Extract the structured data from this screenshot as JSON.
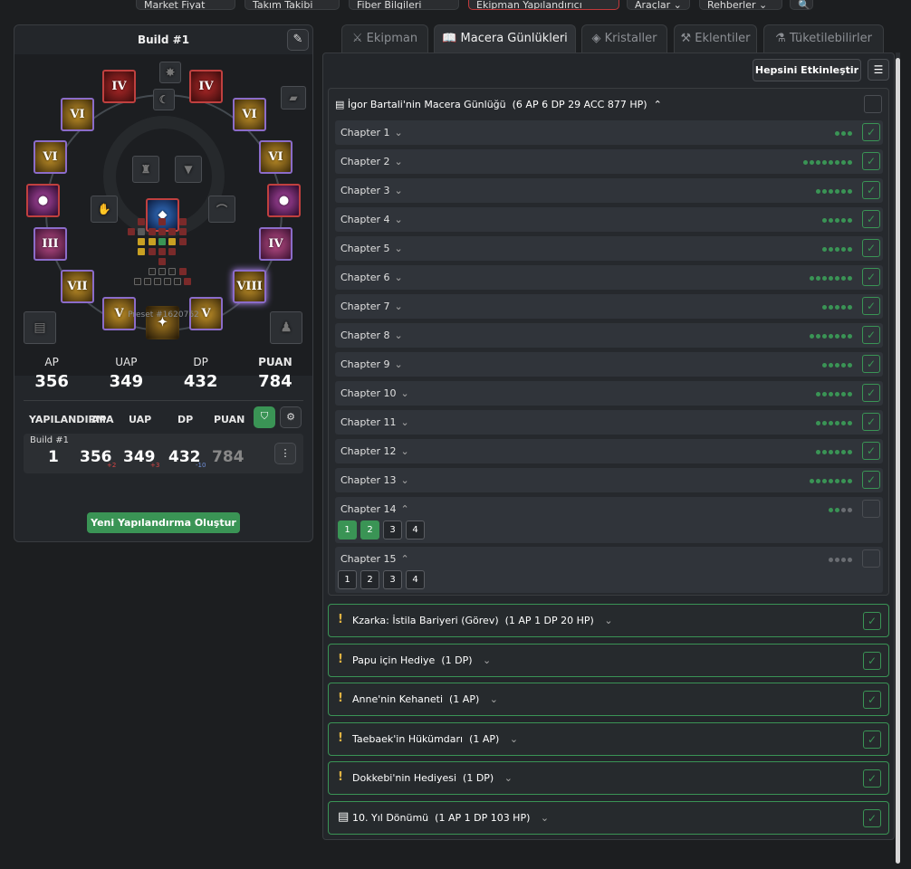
{
  "topnav": [
    {
      "label": "Market Fiyat"
    },
    {
      "label": "Takım Takibi"
    },
    {
      "label": "Fiber Bilgileri"
    },
    {
      "label": "Ekipman Yapılandırıcı",
      "active": true
    },
    {
      "label": "Araçlar ⌄"
    },
    {
      "label": "Rehberler ⌄"
    },
    {
      "label": "🔍"
    }
  ],
  "left": {
    "title": "Build #1",
    "preset": "Preset #1620762",
    "stats": {
      "labels": [
        "AP",
        "UAP",
        "DP",
        "PUAN"
      ],
      "values": [
        "356",
        "349",
        "432",
        "784"
      ]
    },
    "table": {
      "headers": [
        "YAPILANDIRMA",
        "AP",
        "UAP",
        "DP",
        "PUAN"
      ],
      "row": {
        "name": "Build #1",
        "index": "1",
        "ap": "356",
        "ap_delta": "+2",
        "uap": "349",
        "uap_delta": "+3",
        "dp": "432",
        "dp_delta": "-10",
        "score": "784"
      }
    },
    "new_button": "Yeni Yapılandırma Oluştur",
    "sockets": [
      "IV",
      "IV",
      "VI",
      "VI",
      "VI",
      "VI",
      "III",
      "IV",
      "VII",
      "VIII",
      "V",
      "V"
    ]
  },
  "tabs": [
    "Ekipman",
    "Macera Günlükleri",
    "Kristaller",
    "Eklentiler",
    "Tüketilebilirler"
  ],
  "active_tab": "Macera Günlükleri",
  "toolbar": {
    "enable_all": "Hepsini Etkinleştir"
  },
  "journal": {
    "title": "İgor Bartali'nin Macera Günlüğü",
    "bonus": "(6 AP 6 DP 29 ACC 877 HP)",
    "chapters": [
      {
        "label": "Chapter 1",
        "done": 3,
        "total": 3,
        "checked": true
      },
      {
        "label": "Chapter 2",
        "done": 8,
        "total": 8,
        "checked": true
      },
      {
        "label": "Chapter 3",
        "done": 6,
        "total": 6,
        "checked": true
      },
      {
        "label": "Chapter 4",
        "done": 5,
        "total": 5,
        "checked": true
      },
      {
        "label": "Chapter 5",
        "done": 5,
        "total": 5,
        "checked": true
      },
      {
        "label": "Chapter 6",
        "done": 7,
        "total": 7,
        "checked": true
      },
      {
        "label": "Chapter 7",
        "done": 5,
        "total": 5,
        "checked": true
      },
      {
        "label": "Chapter 8",
        "done": 7,
        "total": 7,
        "checked": true
      },
      {
        "label": "Chapter 9",
        "done": 5,
        "total": 5,
        "checked": true
      },
      {
        "label": "Chapter 10",
        "done": 6,
        "total": 6,
        "checked": true
      },
      {
        "label": "Chapter 11",
        "done": 6,
        "total": 6,
        "checked": true
      },
      {
        "label": "Chapter 12",
        "done": 6,
        "total": 6,
        "checked": true
      },
      {
        "label": "Chapter 13",
        "done": 7,
        "total": 7,
        "checked": true
      },
      {
        "label": "Chapter 14",
        "done": 2,
        "total": 4,
        "checked": false,
        "pages": [
          "1",
          "2",
          "3",
          "4"
        ],
        "pages_on": 2
      },
      {
        "label": "Chapter 15",
        "done": 0,
        "total": 4,
        "checked": false,
        "pages": [
          "1",
          "2",
          "3",
          "4"
        ],
        "pages_on": 0
      }
    ]
  },
  "quests": [
    {
      "icon": "!",
      "title": "Kzarka: İstila Bariyeri (Görev)",
      "bonus": "(1 AP 1 DP 20 HP)"
    },
    {
      "icon": "!",
      "title": "Papu için Hediye",
      "bonus": "(1 DP)"
    },
    {
      "icon": "!",
      "title": "Anne'nin Kehaneti",
      "bonus": "(1 AP)"
    },
    {
      "icon": "!",
      "title": "Taebaek'in Hükümdarı",
      "bonus": "(1 AP)"
    },
    {
      "icon": "!",
      "title": "Dokkebi'nin Hediyesi",
      "bonus": "(1 DP)"
    },
    {
      "icon": "book",
      "title": "10. Yıl Dönümü",
      "bonus": "(1 AP 1 DP 103 HP)"
    }
  ],
  "colors": {
    "accent": "#3a9455",
    "gold": "#e0b342",
    "active_tab_border": "#c0393b"
  }
}
